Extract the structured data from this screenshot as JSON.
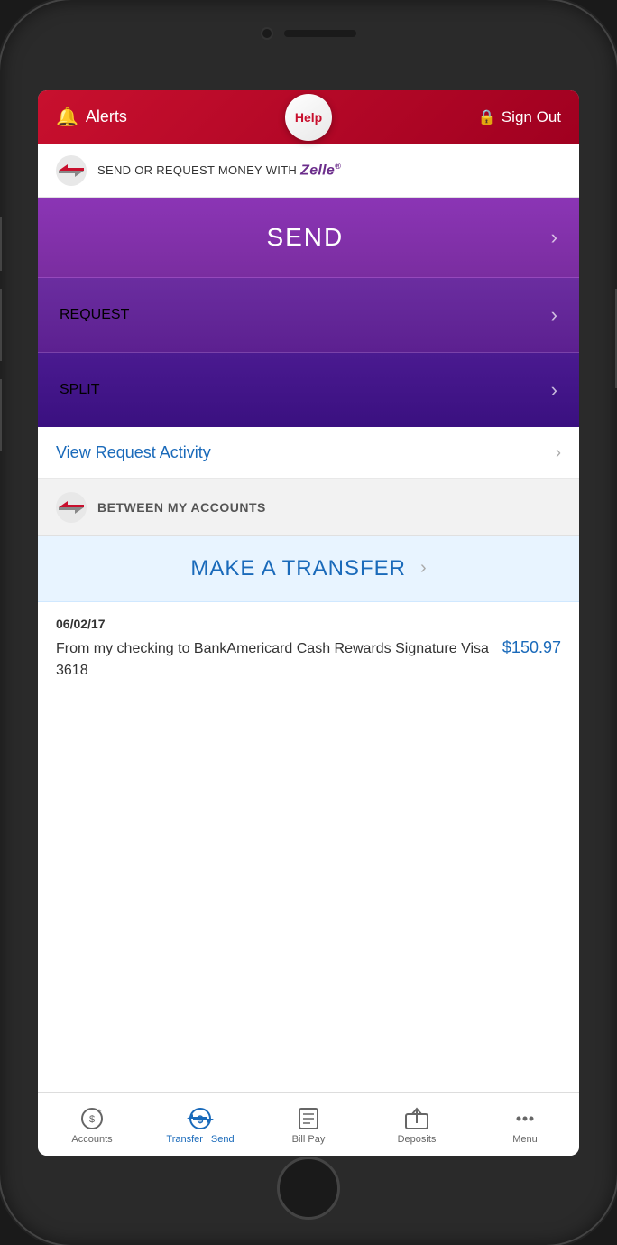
{
  "header": {
    "alerts_label": "Alerts",
    "help_label": "Help",
    "sign_out_label": "Sign Out"
  },
  "zelle_banner": {
    "text": "SEND OR REQUEST MONEY WITH",
    "brand": "Zelle",
    "registered": "®"
  },
  "actions": {
    "send_label": "SEND",
    "request_label": "REQUEST",
    "split_label": "SPLIT",
    "view_request_label": "View Request Activity",
    "between_accounts_label": "BETWEEN MY ACCOUNTS",
    "make_transfer_label": "MAKE A TRANSFER"
  },
  "transaction": {
    "date": "06/02/17",
    "description": "From my checking to BankAmericard Cash Rewards Signature Visa 3618",
    "amount": "$150.97"
  },
  "bottom_nav": {
    "accounts_label": "Accounts",
    "transfer_send_label": "Transfer | Send",
    "bill_pay_label": "Bill Pay",
    "deposits_label": "Deposits",
    "menu_label": "Menu"
  },
  "colors": {
    "header_red": "#c8102e",
    "send_purple": "#8b35b5",
    "request_purple": "#6b2da0",
    "split_purple": "#4a1a90",
    "link_blue": "#1a6aba",
    "zelle_purple": "#6b2d8b",
    "transfer_bg": "#e8f4ff"
  }
}
